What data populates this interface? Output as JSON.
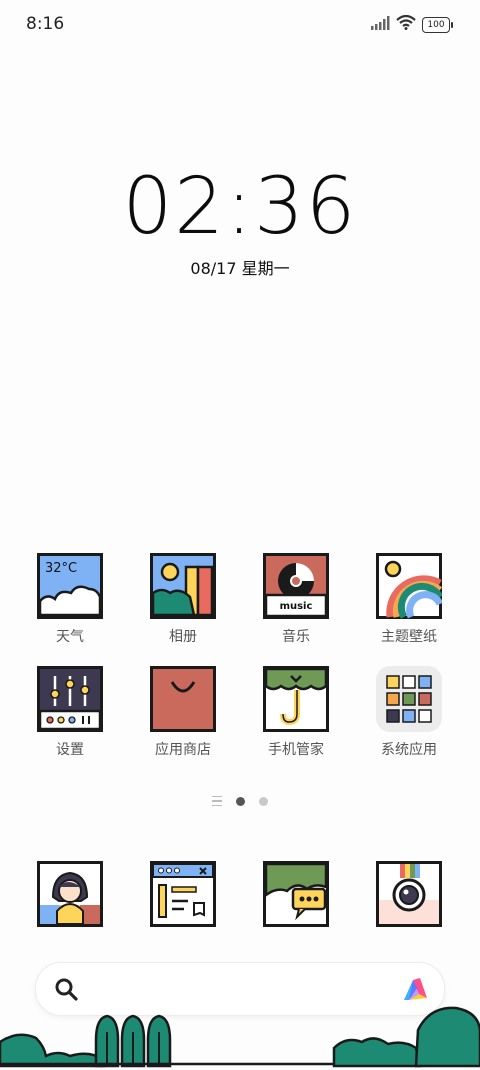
{
  "status": {
    "time": "8:16",
    "battery": "100"
  },
  "clock": {
    "time": "02:36",
    "date": "08/17 星期一"
  },
  "apps": [
    {
      "id": "weather",
      "label": "天气",
      "temp": "32°C"
    },
    {
      "id": "gallery",
      "label": "相册"
    },
    {
      "id": "music",
      "label": "音乐",
      "badge": "music"
    },
    {
      "id": "themes",
      "label": "主题壁纸"
    },
    {
      "id": "settings",
      "label": "设置"
    },
    {
      "id": "app-store",
      "label": "应用商店"
    },
    {
      "id": "security",
      "label": "手机管家"
    },
    {
      "id": "system-apps",
      "label": "系统应用"
    }
  ],
  "page_indicator": {
    "current": 1,
    "pages": 2
  },
  "colors": {
    "outline": "#1a1a1a",
    "teal": "#1d8b73",
    "sky": "#7fb2f5",
    "terracotta": "#c96a5d",
    "olive": "#6f9a55"
  }
}
